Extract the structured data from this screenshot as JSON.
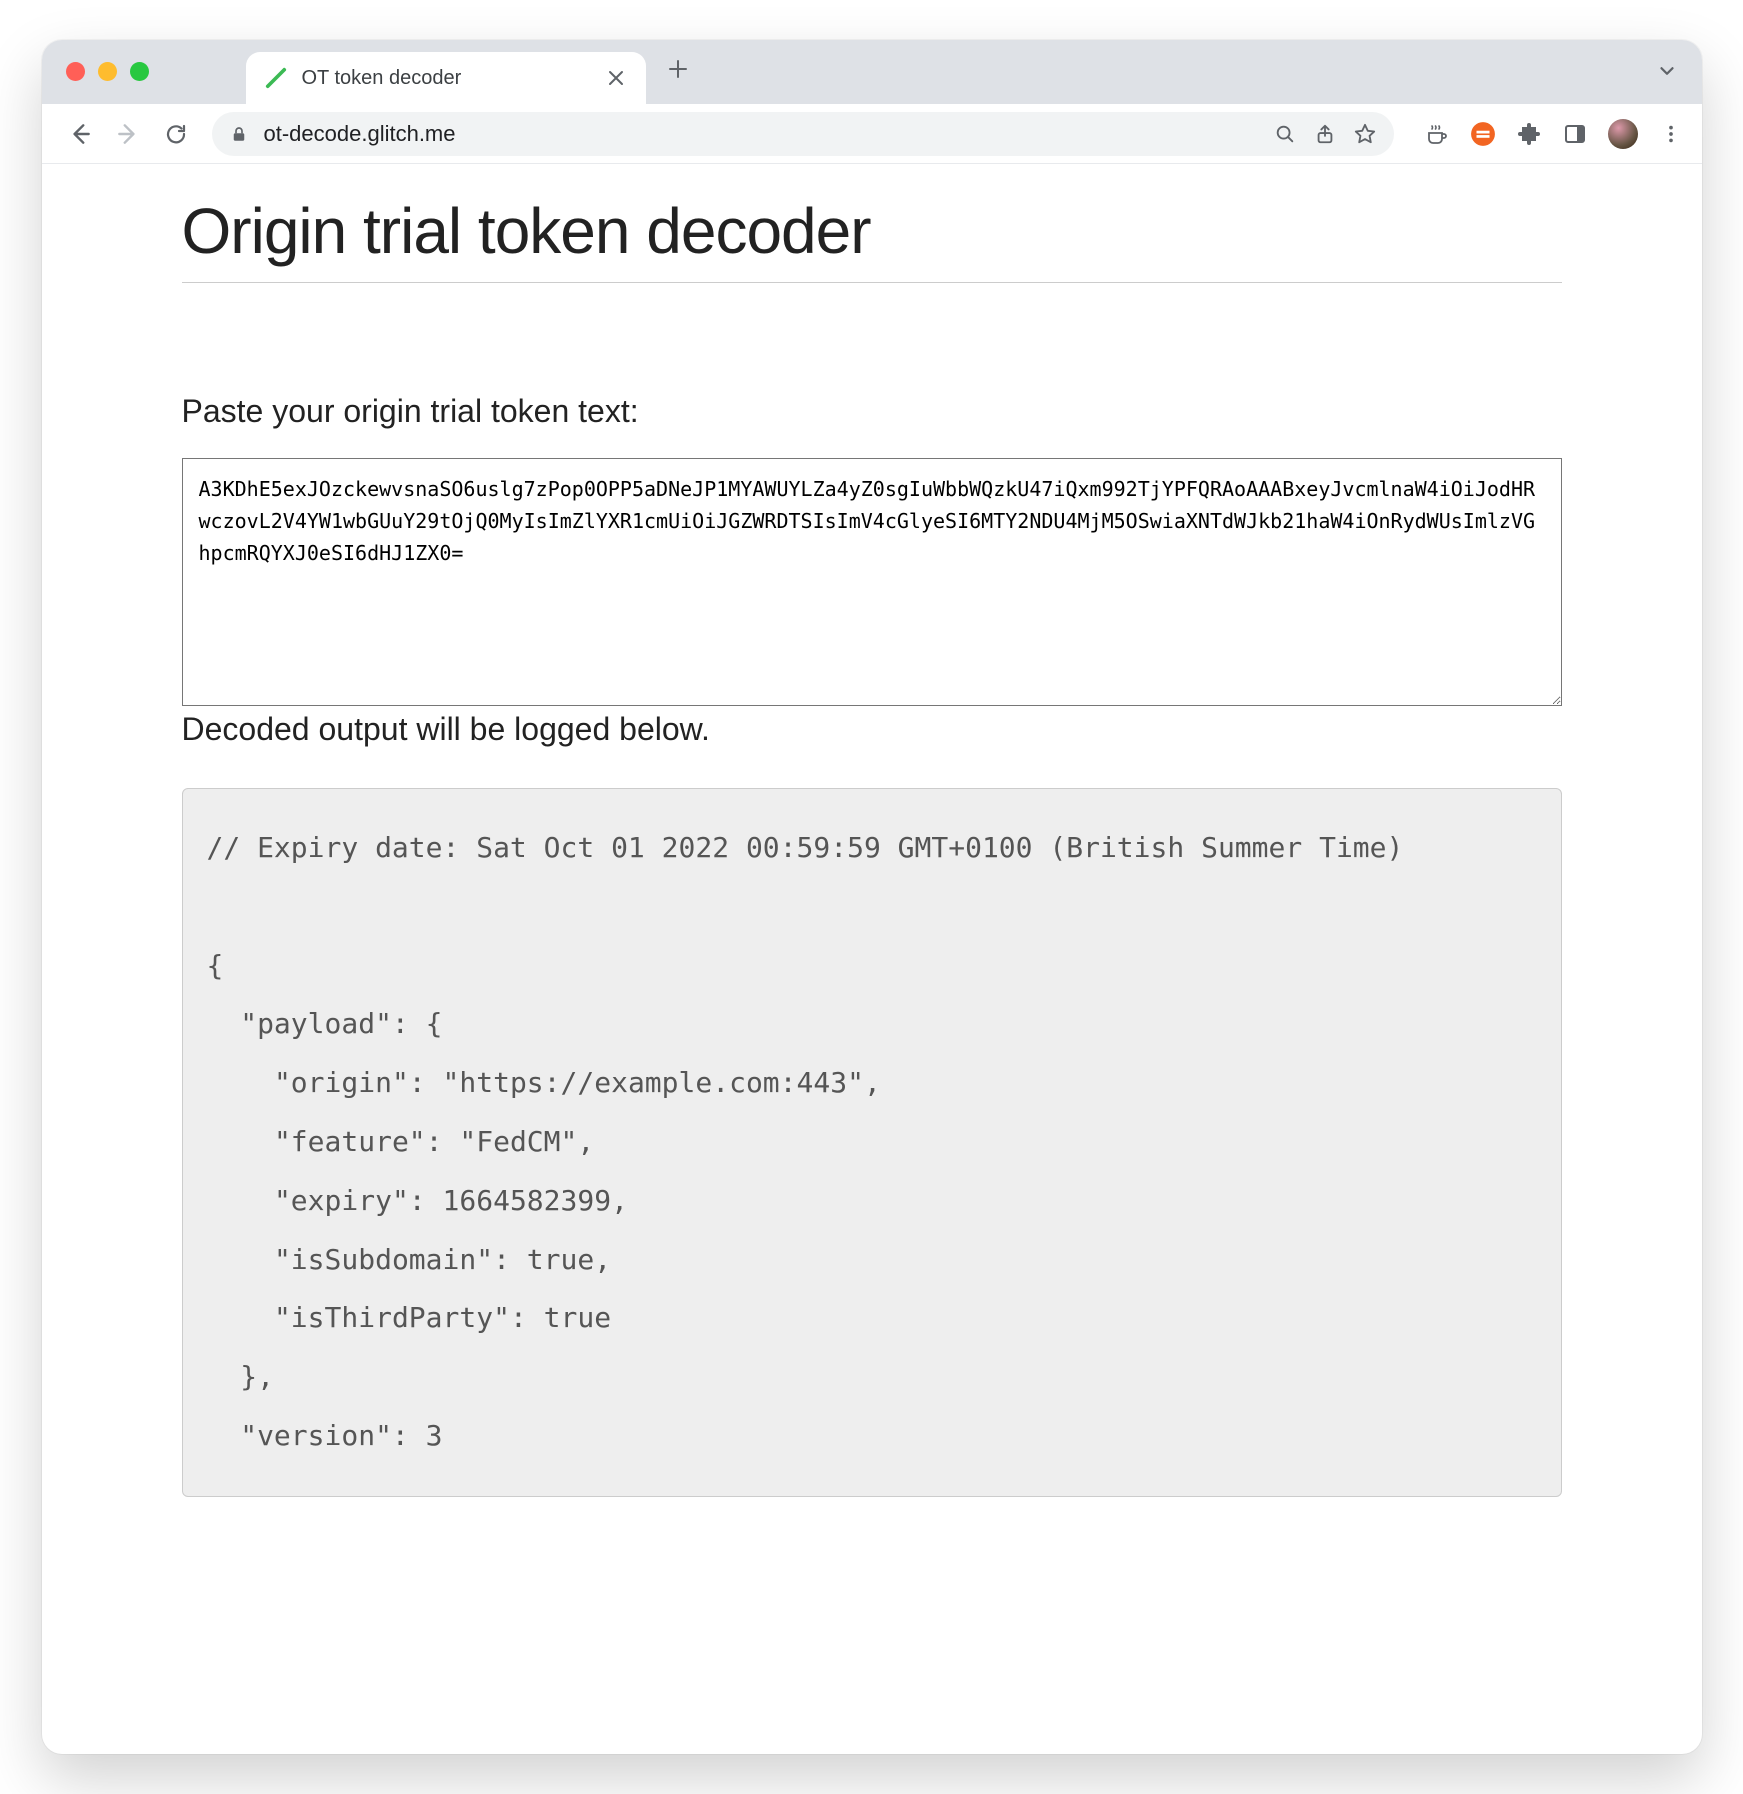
{
  "window": {
    "tab_title": "OT token decoder",
    "url": "ot-decode.glitch.me"
  },
  "page": {
    "title": "Origin trial token decoder",
    "paste_heading": "Paste your origin trial token text:",
    "token_value": "A3KDhE5exJOzckewvsnaSO6uslg7zPop0OPP5aDNeJP1MYAWUYLZa4yZ0sgIuWbbWQzkU47iQxm992TjYPFQRAoAAABxeyJvcmlnaW4iOiJodHRwczovL2V4YW1wbGUuY29tOjQ0MyIsImZlYXR1cmUiOiJGZWRDTSIsImV4cGlyeSI6MTY2NDU4MjM5OSwiaXNTdWJkb21haW4iOnRydWUsImlzVGhpcmRQYXJ0eSI6dHJ1ZX0=",
    "output_heading": "Decoded output will be logged below.",
    "output_text": "// Expiry date: Sat Oct 01 2022 00:59:59 GMT+0100 (British Summer Time)\n\n{\n  \"payload\": {\n    \"origin\": \"https://example.com:443\",\n    \"feature\": \"FedCM\",\n    \"expiry\": 1664582399,\n    \"isSubdomain\": true,\n    \"isThirdParty\": true\n  },\n  \"version\": 3"
  },
  "decoded": {
    "expiry_comment": "Expiry date: Sat Oct 01 2022 00:59:59 GMT+0100 (British Summer Time)",
    "payload": {
      "origin": "https://example.com:443",
      "feature": "FedCM",
      "expiry": 1664582399,
      "isSubdomain": true,
      "isThirdParty": true
    },
    "version": 3
  }
}
